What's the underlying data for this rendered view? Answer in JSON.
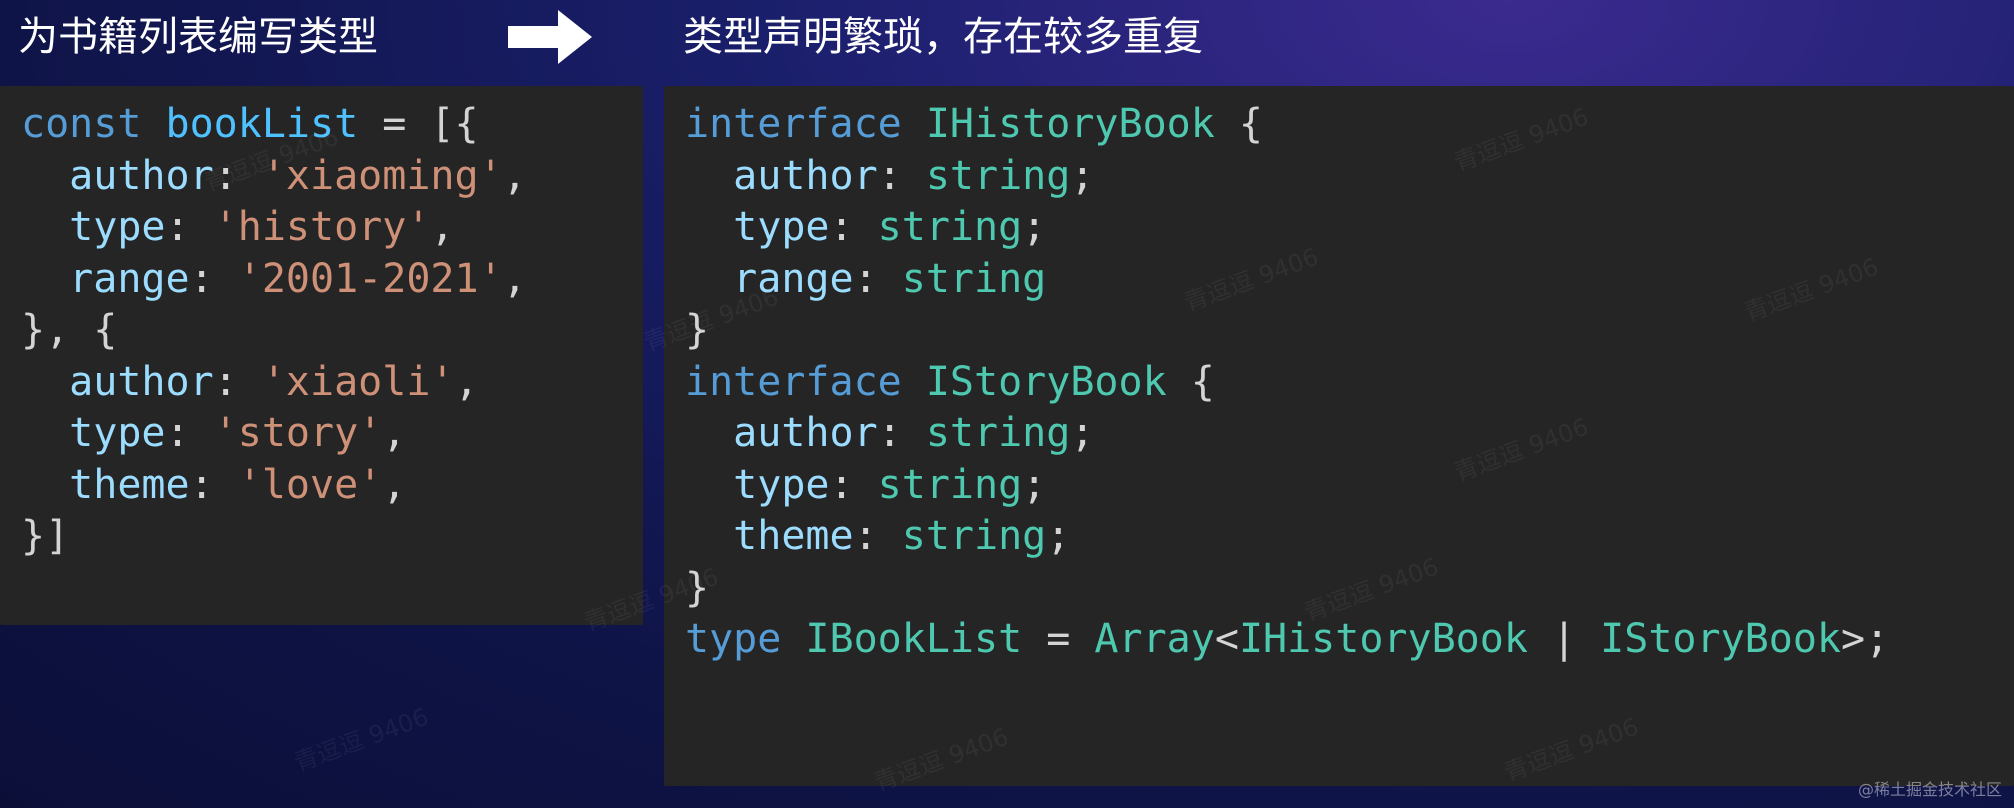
{
  "captions": {
    "left": "为书籍列表编写类型",
    "right": "类型声明繁琐，存在较多重复"
  },
  "arrow_icon": "right-arrow-icon",
  "left_code": [
    [
      [
        "kw",
        "const"
      ],
      [
        "pun",
        " "
      ],
      [
        "var",
        "bookList"
      ],
      [
        "pun",
        " = [{"
      ]
    ],
    [
      [
        "pun",
        "  "
      ],
      [
        "prop",
        "author"
      ],
      [
        "pun",
        ": "
      ],
      [
        "str",
        "'xiaoming'"
      ],
      [
        "pun",
        ","
      ]
    ],
    [
      [
        "pun",
        "  "
      ],
      [
        "prop",
        "type"
      ],
      [
        "pun",
        ": "
      ],
      [
        "str",
        "'history'"
      ],
      [
        "pun",
        ","
      ]
    ],
    [
      [
        "pun",
        "  "
      ],
      [
        "prop",
        "range"
      ],
      [
        "pun",
        ": "
      ],
      [
        "str",
        "'2001-2021'"
      ],
      [
        "pun",
        ","
      ]
    ],
    [
      [
        "pun",
        "}, {"
      ]
    ],
    [
      [
        "pun",
        "  "
      ],
      [
        "prop",
        "author"
      ],
      [
        "pun",
        ": "
      ],
      [
        "str",
        "'xiaoli'"
      ],
      [
        "pun",
        ","
      ]
    ],
    [
      [
        "pun",
        "  "
      ],
      [
        "prop",
        "type"
      ],
      [
        "pun",
        ": "
      ],
      [
        "str",
        "'story'"
      ],
      [
        "pun",
        ","
      ]
    ],
    [
      [
        "pun",
        "  "
      ],
      [
        "prop",
        "theme"
      ],
      [
        "pun",
        ": "
      ],
      [
        "str",
        "'love'"
      ],
      [
        "pun",
        ","
      ]
    ],
    [
      [
        "pun",
        "}]"
      ]
    ]
  ],
  "right_code": [
    [
      [
        "kw",
        "interface"
      ],
      [
        "pun",
        " "
      ],
      [
        "typ",
        "IHistoryBook"
      ],
      [
        "pun",
        " {"
      ]
    ],
    [
      [
        "pun",
        "  "
      ],
      [
        "prop",
        "author"
      ],
      [
        "pun",
        ": "
      ],
      [
        "typ",
        "string"
      ],
      [
        "pun",
        ";"
      ]
    ],
    [
      [
        "pun",
        "  "
      ],
      [
        "prop",
        "type"
      ],
      [
        "pun",
        ": "
      ],
      [
        "typ",
        "string"
      ],
      [
        "pun",
        ";"
      ]
    ],
    [
      [
        "pun",
        "  "
      ],
      [
        "prop",
        "range"
      ],
      [
        "pun",
        ": "
      ],
      [
        "typ",
        "string"
      ]
    ],
    [
      [
        "pun",
        "}"
      ]
    ],
    [
      [
        "kw",
        "interface"
      ],
      [
        "pun",
        " "
      ],
      [
        "typ",
        "IStoryBook"
      ],
      [
        "pun",
        " {"
      ]
    ],
    [
      [
        "pun",
        "  "
      ],
      [
        "prop",
        "author"
      ],
      [
        "pun",
        ": "
      ],
      [
        "typ",
        "string"
      ],
      [
        "pun",
        ";"
      ]
    ],
    [
      [
        "pun",
        "  "
      ],
      [
        "prop",
        "type"
      ],
      [
        "pun",
        ": "
      ],
      [
        "typ",
        "string"
      ],
      [
        "pun",
        ";"
      ]
    ],
    [
      [
        "pun",
        "  "
      ],
      [
        "prop",
        "theme"
      ],
      [
        "pun",
        ": "
      ],
      [
        "typ",
        "string"
      ],
      [
        "pun",
        ";"
      ]
    ],
    [
      [
        "pun",
        "}"
      ]
    ],
    [
      [
        "kw",
        "type"
      ],
      [
        "pun",
        " "
      ],
      [
        "typ",
        "IBookList"
      ],
      [
        "pun",
        " = "
      ],
      [
        "typ",
        "Array"
      ],
      [
        "pun",
        "<"
      ],
      [
        "typ",
        "IHistoryBook"
      ],
      [
        "pun",
        " | "
      ],
      [
        "typ",
        "IStoryBook"
      ],
      [
        "pun",
        ">;"
      ]
    ]
  ],
  "watermark_text": "青逗逗 9406",
  "credit": "@稀土掘金技术社区"
}
